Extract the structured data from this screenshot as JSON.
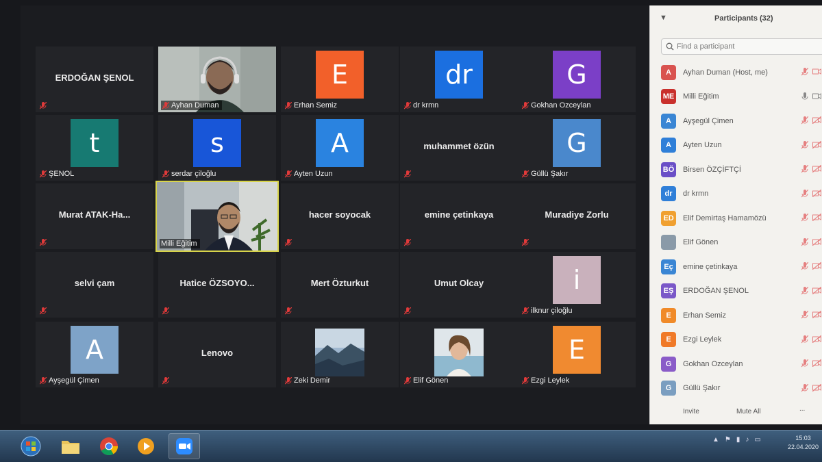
{
  "tiles": [
    {
      "name": "ERDOĞAN ŞENOL",
      "label": ""
    },
    {
      "name": "",
      "label": "Ayhan Duman"
    },
    {
      "name": "",
      "label": "Erhan Semiz",
      "initial": "E"
    },
    {
      "name": "",
      "label": "dr krmn",
      "initial": "dr"
    },
    {
      "name": "",
      "label": "Gokhan Ozceylan",
      "initial": "G"
    },
    {
      "name": "",
      "label": "ŞENOL",
      "initial": "t"
    },
    {
      "name": "",
      "label": "serdar çiloğlu",
      "initial": "s"
    },
    {
      "name": "",
      "label": "Ayten Uzun",
      "initial": "A"
    },
    {
      "name": "muhammet özün",
      "label": ""
    },
    {
      "name": "",
      "label": "Güllü Şakır",
      "initial": "G"
    },
    {
      "name": "Murat ATAK-Ha...",
      "label": ""
    },
    {
      "name": "",
      "label": "Milli Eğitim"
    },
    {
      "name": "hacer soyocak",
      "label": ""
    },
    {
      "name": "emine çetinkaya",
      "label": ""
    },
    {
      "name": "Muradiye Zorlu",
      "label": ""
    },
    {
      "name": "selvi çam",
      "label": ""
    },
    {
      "name": "Hatice ÖZSOYO...",
      "label": ""
    },
    {
      "name": "Mert Özturkut",
      "label": ""
    },
    {
      "name": "Umut Olcay",
      "label": ""
    },
    {
      "name": "",
      "label": "ilknur çiloğlu",
      "initial": "i"
    },
    {
      "name": "",
      "label": "Ayşegül Çimen",
      "initial": "A"
    },
    {
      "name": "Lenovo",
      "label": ""
    },
    {
      "name": "",
      "label": "Zeki Demir"
    },
    {
      "name": "",
      "label": "Elif Gönen"
    },
    {
      "name": "",
      "label": "Ezgi Leylek",
      "initial": "E"
    }
  ],
  "panel": {
    "title": "Participants (32)",
    "search_placeholder": "Find a participant",
    "participants": [
      {
        "initials": "A",
        "name": "Ayhan Duman (Host, me)",
        "color": "#d9534f"
      },
      {
        "initials": "ME",
        "name": "Milli Eğitim",
        "color": "#c9302c"
      },
      {
        "initials": "A",
        "name": "Ayşegül Çimen",
        "color": "#3a86d4"
      },
      {
        "initials": "A",
        "name": "Ayten Uzun",
        "color": "#2f7fd8"
      },
      {
        "initials": "BÖ",
        "name": "Birsen ÖZÇİFTÇİ",
        "color": "#6a4fc7"
      },
      {
        "initials": "dr",
        "name": "dr krmn",
        "color": "#2f7fd8"
      },
      {
        "initials": "ED",
        "name": "Elif Demirtaş Hamamözü",
        "color": "#f0a030"
      },
      {
        "initials": "",
        "name": "Elif Gönen",
        "color": "#8a9aa8"
      },
      {
        "initials": "Eç",
        "name": "emine çetinkaya",
        "color": "#3a86d4"
      },
      {
        "initials": "EŞ",
        "name": "ERDOĞAN ŞENOL",
        "color": "#7a58c8"
      },
      {
        "initials": "E",
        "name": "Erhan Semiz",
        "color": "#f08a28"
      },
      {
        "initials": "E",
        "name": "Ezgi Leylek",
        "color": "#f07a28"
      },
      {
        "initials": "G",
        "name": "Gokhan Ozceylan",
        "color": "#8a5cc8"
      },
      {
        "initials": "G",
        "name": "Güllü Şakır",
        "color": "#7a9ec0"
      }
    ],
    "invite_label": "Invite",
    "mute_all_label": "Mute All",
    "more_label": "..."
  },
  "clock": {
    "time": "15:03",
    "date": "22.04.2020"
  }
}
